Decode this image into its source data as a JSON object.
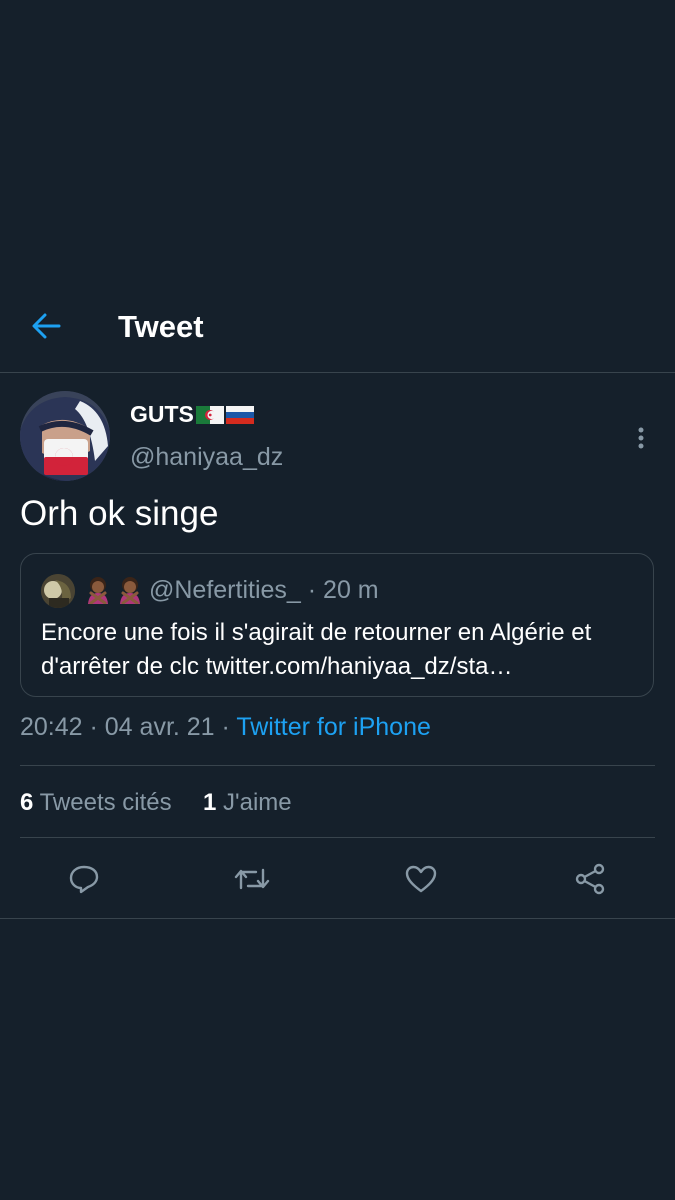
{
  "header": {
    "title": "Tweet",
    "back_icon": "arrow-left-icon",
    "accent": "#1da1f2"
  },
  "tweet": {
    "display_name": "GUTS",
    "flags": [
      "algeria-flag-icon",
      "russia-flag-icon"
    ],
    "handle": "@haniyaa_dz",
    "text": "Orh ok singe",
    "more_icon": "more-vertical-icon",
    "time": "20:42",
    "date": "04 avr. 21",
    "source": "Twitter for iPhone",
    "separator": " · "
  },
  "quote": {
    "emojis": [
      "person-gesturing-no-emoji",
      "person-gesturing-no-emoji"
    ],
    "handle": "@Nefertities_",
    "age": "20 m",
    "text": "Encore une fois il s'agirait de retourner en Algérie et d'arrêter de clc twitter.com/haniyaa_dz/sta…"
  },
  "stats": {
    "quotes_count": "6",
    "quotes_label": "Tweets cités",
    "likes_count": "1",
    "likes_label": "J'aime"
  },
  "actions": {
    "reply_icon": "reply-icon",
    "retweet_icon": "retweet-icon",
    "like_icon": "heart-icon",
    "share_icon": "share-icon"
  },
  "colors": {
    "background": "#15202b",
    "border": "#38444d",
    "secondary_text": "#8899a6",
    "link": "#1da1f2"
  }
}
